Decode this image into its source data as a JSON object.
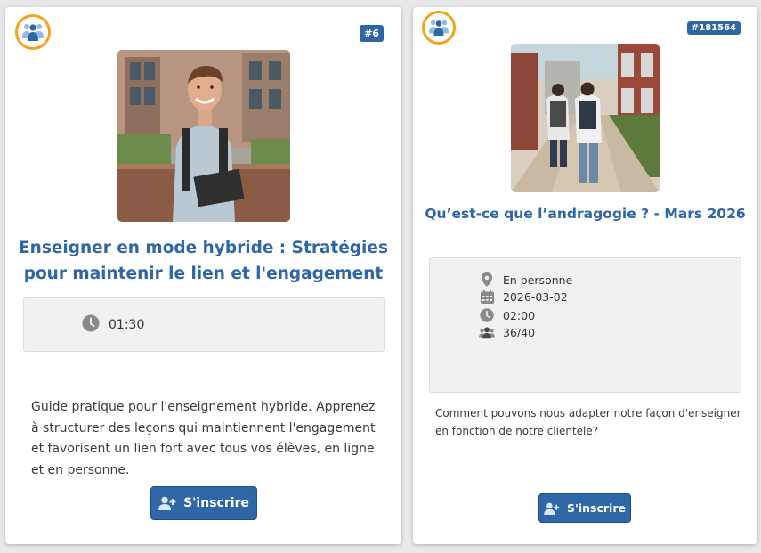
{
  "cards": [
    {
      "badge": "#6",
      "title": "Enseigner en mode hybride : Stratégies pour maintenir le lien et l'engagement",
      "duration": "01:30",
      "description": "Guide pratique pour l'enseignement hybride. Apprenez à structurer des leçons qui maintiennent l'engagement et favorisent un lien fort avec tous vos élèves, en ligne et en personne.",
      "button_label": "S'inscrire"
    },
    {
      "badge": "#181564",
      "title": "Qu’est-ce que l’andragogie ? - Mars 2026",
      "mode": "En personne",
      "date": "2026-03-02",
      "duration": "02:00",
      "capacity": "36/40",
      "description": "Comment pouvons nous adapter notre façon d'enseigner en fonction de notre clientèle?",
      "button_label": "S'inscrire"
    }
  ],
  "icons": [
    "group-icon",
    "clock-icon",
    "map-pin-icon",
    "calendar-icon",
    "people-icon",
    "user-plus-icon"
  ],
  "colors": {
    "accent": "#2f66a6",
    "ring": "#f2a31b",
    "icon_gray": "#8a8a8a"
  }
}
